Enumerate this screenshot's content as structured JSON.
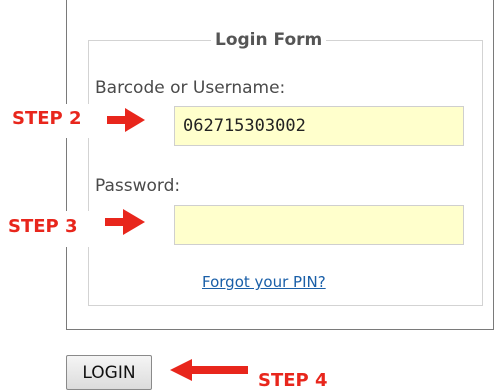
{
  "form": {
    "legend": "Login Form",
    "username_label": "Barcode or Username:",
    "username_value": "062715303002",
    "password_label": "Password:",
    "password_value": "",
    "forgot_link": "Forgot your PIN?",
    "login_button": "LOGIN"
  },
  "annotations": {
    "step2": "STEP 2",
    "step3": "STEP 3",
    "step4": "STEP 4",
    "color": "#e8261c"
  }
}
